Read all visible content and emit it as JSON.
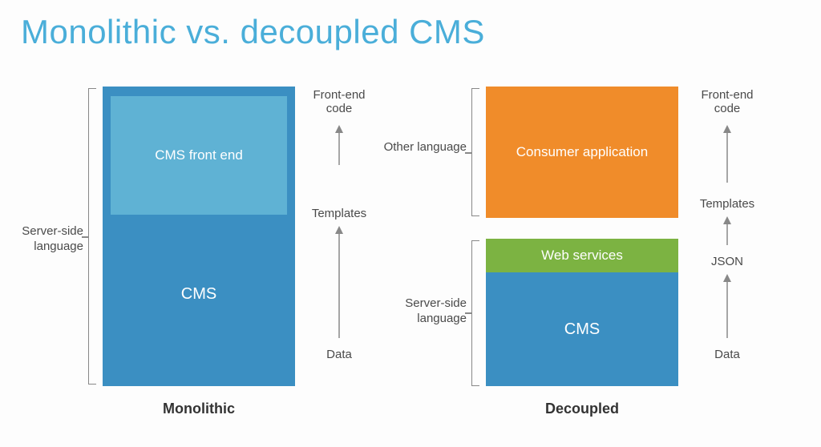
{
  "title": "Monolithic vs. decoupled CMS",
  "monolithic": {
    "bracket_label": "Server-side language",
    "front_end_label": "CMS front end",
    "cms_label": "CMS",
    "caption": "Monolithic",
    "arrow": {
      "top": "Front-end code",
      "mid": "Templates",
      "bottom": "Data"
    }
  },
  "decoupled": {
    "other_bracket_label": "Other language",
    "server_bracket_label": "Server-side language",
    "consumer_label": "Consumer application",
    "web_services_label": "Web services",
    "cms_label": "CMS",
    "caption": "Decoupled",
    "arrow": {
      "top": "Front-end code",
      "mid": "Templates",
      "json": "JSON",
      "bottom": "Data"
    }
  }
}
